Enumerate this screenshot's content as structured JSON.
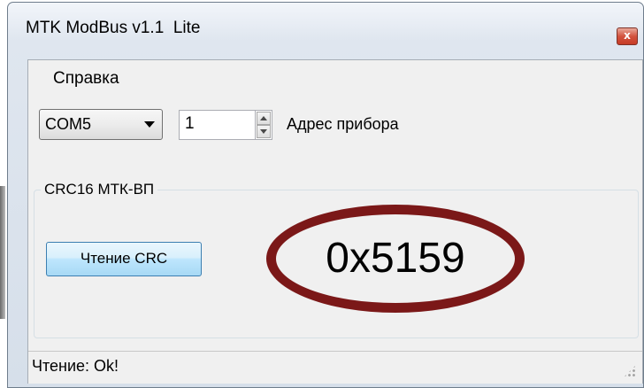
{
  "window": {
    "title": "MTK ModBus v1.1  Lite",
    "close_label": "x"
  },
  "menu": {
    "items": [
      {
        "label": "Справка"
      }
    ]
  },
  "port": {
    "selected": "COM5"
  },
  "address": {
    "value": "1",
    "label": "Адрес прибора"
  },
  "crc_group": {
    "title": "CRC16 МТК-ВП",
    "read_button": "Чтение CRC",
    "value": "0x5159",
    "highlight_color": "#7b1818"
  },
  "status": {
    "text": "Чтение: Ok!"
  }
}
